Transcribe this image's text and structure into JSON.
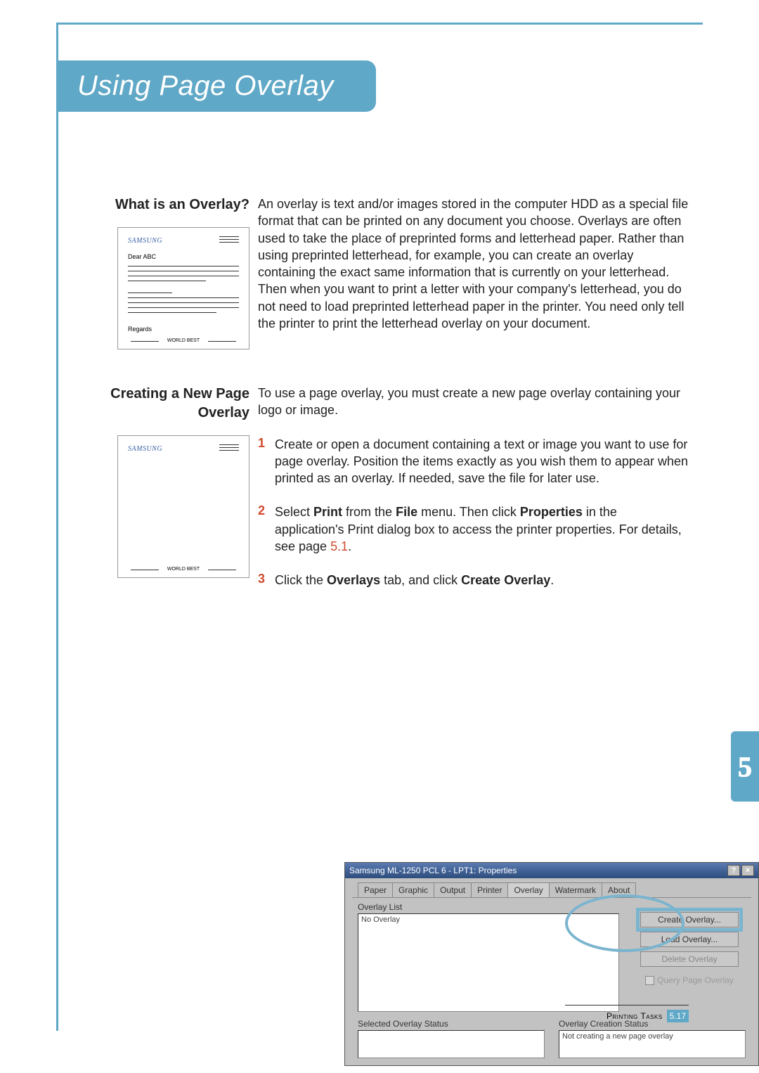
{
  "title": "Using Page Overlay",
  "chapter_marker": "5",
  "section1": {
    "heading": "What is an Overlay?",
    "body": "An overlay is text and/or images stored in the computer HDD as a special file format that can be printed on any document you choose. Overlays are often used to take the place of preprinted forms and letterhead paper. Rather than using preprinted letterhead, for example, you can create an overlay containing the exact same information that is currently on your letterhead. Then when you want to print a letter with your company's letterhead, you do not need to load preprinted letterhead paper in the printer. You need only tell the printer to print the letterhead overlay on your document.",
    "sample": {
      "brand": "SAMSUNG",
      "greeting": "Dear ABC",
      "signoff": "Regards",
      "footer": "WORLD BEST"
    }
  },
  "section2": {
    "heading": "Creating a New Page Overlay",
    "intro": "To use a page overlay, you must create a new page overlay containing your logo or image.",
    "steps": [
      {
        "n": "1",
        "text": "Create or open a document containing a text or image you want to use for page overlay. Position the items exactly as you wish them to appear when printed as an overlay. If needed, save the file for later use."
      },
      {
        "n": "2",
        "pre": "Select ",
        "b1": "Print",
        "mid1": " from the ",
        "b2": "File",
        "mid2": " menu. Then click ",
        "b3": "Properties",
        "post": " in the application's Print dialog box to access the printer properties. For details, see page ",
        "ref": "5.1",
        "tail": "."
      },
      {
        "n": "3",
        "pre": "Click the ",
        "b1": "Overlays",
        "mid1": " tab, and click ",
        "b2": "Create Overlay",
        "post": "."
      }
    ],
    "sample_footer": "WORLD BEST"
  },
  "screenshot": {
    "window_title": "Samsung ML-1250 PCL 6 - LPT1: Properties",
    "help_btn": "?",
    "close_btn": "×",
    "tabs": [
      "Paper",
      "Graphic",
      "Output",
      "Printer",
      "Overlay",
      "Watermark",
      "About"
    ],
    "overlay_list_label": "Overlay List",
    "no_overlay": "No Overlay",
    "btn_create": "Create Overlay...",
    "btn_load": "Load Overlay...",
    "btn_delete": "Delete Overlay",
    "chk_query": "Query Page Overlay",
    "sel_status_label": "Selected Overlay Status",
    "cre_status_label": "Overlay Creation Status",
    "cre_status_value": "Not creating a new page overlay"
  },
  "footer": {
    "label": "Printing Tasks",
    "page": "5.17"
  }
}
